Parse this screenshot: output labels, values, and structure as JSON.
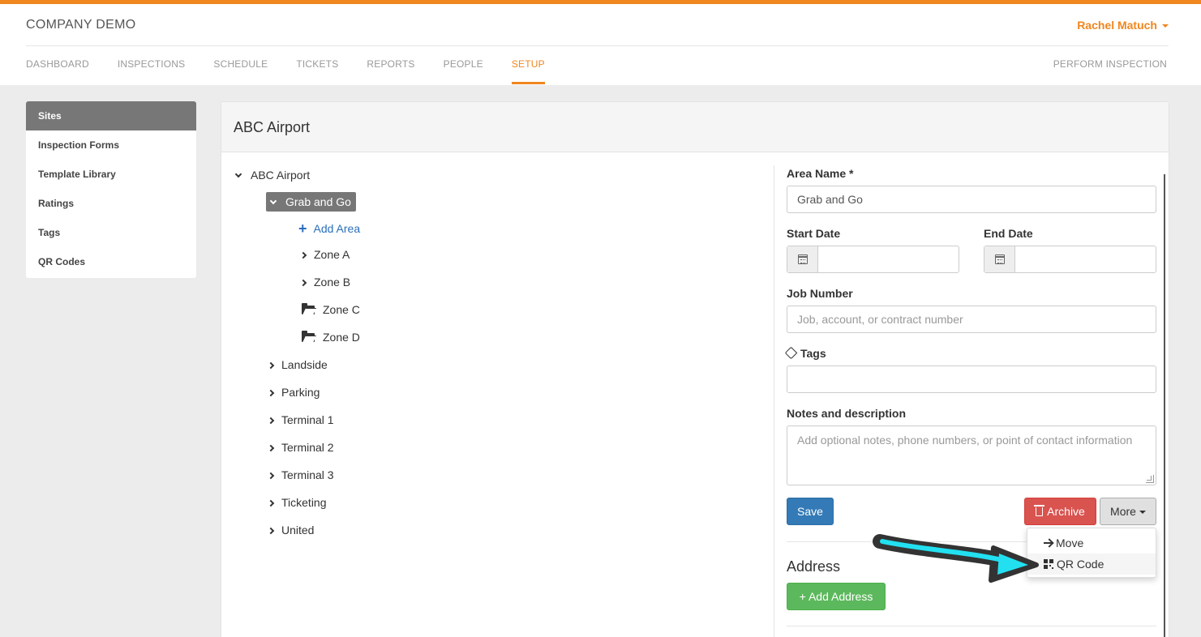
{
  "header": {
    "company": "COMPANY DEMO",
    "user": "Rachel Matuch",
    "perform": "PERFORM INSPECTION",
    "accent": "#f0861e"
  },
  "nav": [
    "DASHBOARD",
    "INSPECTIONS",
    "SCHEDULE",
    "TICKETS",
    "REPORTS",
    "PEOPLE",
    "SETUP"
  ],
  "nav_active": "SETUP",
  "sidebar": [
    "Sites",
    "Inspection Forms",
    "Template Library",
    "Ratings",
    "Tags",
    "QR Codes"
  ],
  "sidebar_active": "Sites",
  "panel": {
    "title": "ABC Airport"
  },
  "tree": {
    "root": "ABC Airport",
    "selected": "Grab and Go",
    "add_area": "Add Area",
    "children_of_selected": [
      "Zone A",
      "Zone B",
      "Zone C",
      "Zone D"
    ],
    "siblings": [
      "Landside",
      "Parking",
      "Terminal 1",
      "Terminal 2",
      "Terminal 3",
      "Ticketing",
      "United"
    ]
  },
  "form": {
    "area_name_label": "Area Name *",
    "area_name_value": "Grab and Go",
    "start_date_label": "Start Date",
    "end_date_label": "End Date",
    "job_number_label": "Job Number",
    "job_number_placeholder": "Job, account, or contract number",
    "tags_label": "Tags",
    "notes_label": "Notes and description",
    "notes_placeholder": "Add optional notes, phone numbers, or point of contact information",
    "save": "Save",
    "archive": "Archive",
    "more": "More",
    "address_title": "Address",
    "add_address": "+ Add Address"
  },
  "more_menu": [
    "Move",
    "QR Code"
  ],
  "more_menu_highlighted": "QR Code",
  "colors": {
    "save": "#337ab7",
    "archive": "#d9534f",
    "add_address": "#5cb85c",
    "annotation_arrow": "#22e0f0"
  }
}
